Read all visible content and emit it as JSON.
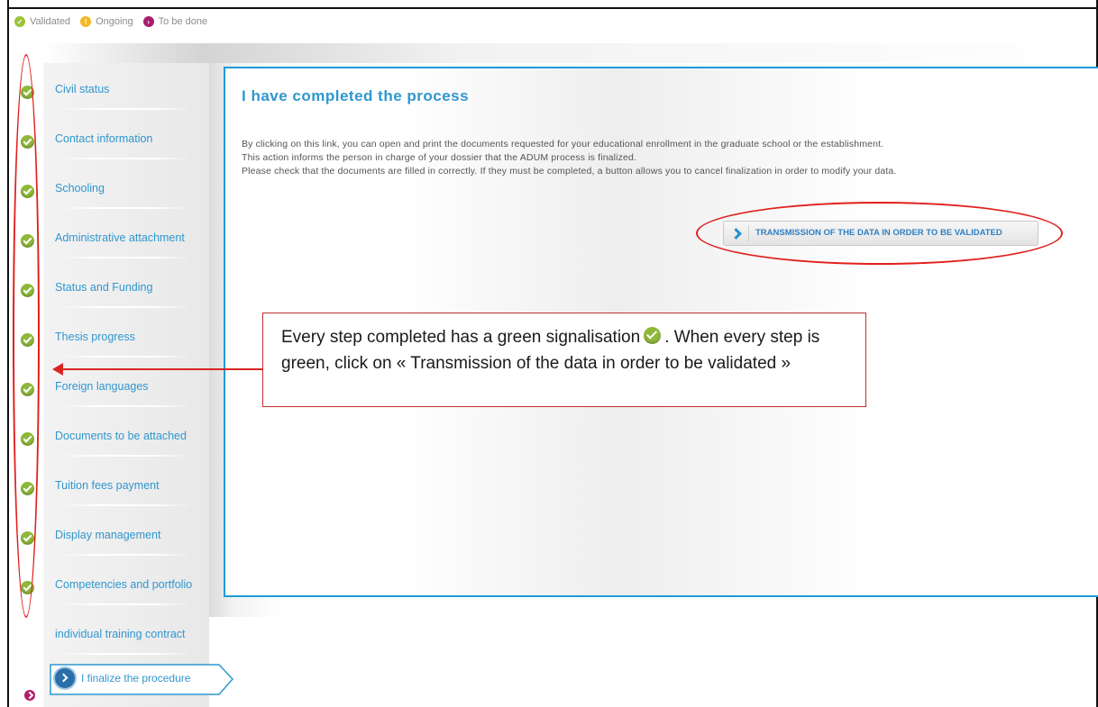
{
  "legend": {
    "validated": "Validated",
    "ongoing": "Ongoing",
    "to_be_done": "To be done"
  },
  "sidebar": {
    "items": [
      {
        "label": "Civil status",
        "status": "validated"
      },
      {
        "label": "Contact information",
        "status": "validated"
      },
      {
        "label": "Schooling",
        "status": "validated"
      },
      {
        "label": "Administrative attachment",
        "status": "validated"
      },
      {
        "label": "Status and Funding",
        "status": "validated"
      },
      {
        "label": "Thesis progress",
        "status": "validated"
      },
      {
        "label": "Foreign languages",
        "status": "validated"
      },
      {
        "label": "Documents to be attached",
        "status": "validated"
      },
      {
        "label": "Tuition fees payment",
        "status": "validated"
      },
      {
        "label": "Display management",
        "status": "validated"
      },
      {
        "label": "Competencies and portfolio",
        "status": "validated"
      },
      {
        "label": "individual training contract",
        "status": "none"
      }
    ],
    "finalize": {
      "label": "I finalize the procedure",
      "status": "to_be_done"
    }
  },
  "content": {
    "title": "I have completed the process",
    "paragraph_lines": [
      "By clicking on this link, you can open and print the documents requested for your educational enrollment in the graduate school or the establishment.",
      "This action informs the person in charge of your dossier that the ADUM process is finalized.",
      "Please check that the documents are filled in correctly. If they must be completed, a button allows you to cancel finalization in order to modify your data."
    ],
    "transmit_button": "TRANSMISSION OF THE DATA IN ORDER TO BE VALIDATED"
  },
  "annotation": {
    "line1_before": "Every step completed has a green signalisation",
    "line1_after": ". When every step is",
    "line2": "green, click on « Transmission of the data in order to be validated »"
  },
  "colors": {
    "accent_blue": "#2f97cf",
    "panel_border": "#1f9bd6",
    "validated_green": "#8fb83a",
    "ongoing_yellow": "#f2b824",
    "todo_magenta": "#b01f6b",
    "annotation_red": "#e0201b"
  }
}
